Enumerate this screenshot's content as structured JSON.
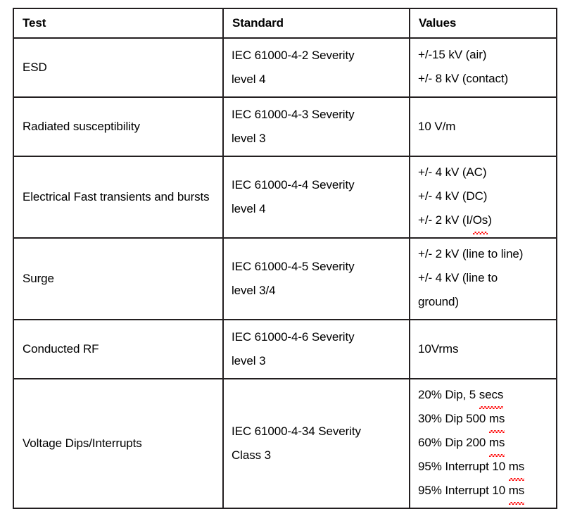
{
  "table": {
    "columns": [
      "Test",
      "Standard",
      "Values"
    ],
    "rows": [
      {
        "test": "ESD",
        "standard_lines": [
          "IEC 61000-4-2 Severity",
          "level 4"
        ],
        "value_lines": [
          {
            "text": "+/-15 kV (air)",
            "misspelled": null
          },
          {
            "text": "+/- 8 kV (contact)",
            "misspelled": null
          }
        ]
      },
      {
        "test": "Radiated susceptibility",
        "standard_lines": [
          "IEC 61000-4-3 Severity",
          "level 3"
        ],
        "value_lines": [
          {
            "text": "10 V/m",
            "misspelled": null
          }
        ]
      },
      {
        "test": "Electrical Fast transients and bursts",
        "standard_lines": [
          "IEC 61000-4-4 Severity",
          "level 4"
        ],
        "value_lines": [
          {
            "text": "+/- 4 kV (AC)",
            "misspelled": null
          },
          {
            "text": "+/- 4 kV (DC)",
            "misspelled": null
          },
          {
            "text": "+/- 2 kV (I/Os)",
            "misspelled": "Os"
          }
        ]
      },
      {
        "test": "Surge",
        "standard_lines": [
          "IEC 61000-4-5 Severity",
          "level 3/4"
        ],
        "value_lines": [
          {
            "text": "+/- 2 kV (line to line)",
            "misspelled": null
          },
          {
            "text": "+/- 4 kV (line to",
            "misspelled": null
          },
          {
            "text": "ground)",
            "misspelled": null
          }
        ]
      },
      {
        "test": "Conducted RF",
        "standard_lines": [
          "IEC 61000-4-6 Severity",
          "level 3"
        ],
        "value_lines": [
          {
            "text": "10Vrms",
            "misspelled": null
          }
        ]
      },
      {
        "test": "Voltage Dips/Interrupts",
        "standard_lines": [
          "IEC 61000-4-34 Severity",
          "Class 3"
        ],
        "value_lines": [
          {
            "text": "20% Dip, 5 secs",
            "misspelled": "secs"
          },
          {
            "text": "30% Dip 500 ms",
            "misspelled": "ms"
          },
          {
            "text": "60% Dip 200 ms",
            "misspelled": "ms"
          },
          {
            "text": "95% Interrupt 10 ms",
            "misspelled": "ms"
          },
          {
            "text": "95% Interrupt 10 ms",
            "misspelled": "ms"
          }
        ]
      }
    ]
  },
  "colors": {
    "border": "#231f20",
    "text": "#000000",
    "spellcheck_underline": "#ff0000",
    "background": "#ffffff"
  }
}
